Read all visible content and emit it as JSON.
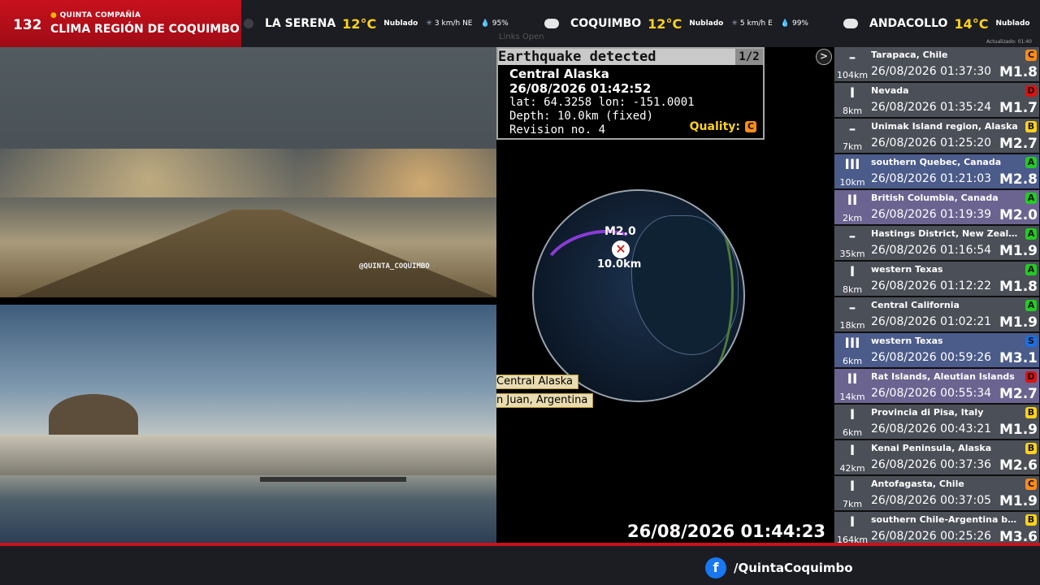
{
  "brand": {
    "number": "132",
    "subtitle": "QUINTA COMPAÑÍA",
    "title": "CLIMA REGIÓN DE COQUIMBO"
  },
  "weather": [
    {
      "city": "LA SERENA",
      "temp": "12°C",
      "cond": "Nublado",
      "wind": "3 km/h NE",
      "hum": "95%",
      "icon": "cloud-icon-dark"
    },
    {
      "city": "COQUIMBO",
      "temp": "12°C",
      "cond": "Nublado",
      "wind": "5 km/h E",
      "hum": "99%",
      "icon": "cloud-icon"
    },
    {
      "city": "ANDACOLLO",
      "temp": "14°C",
      "cond": "Nublado",
      "icon": "cloud-icon"
    }
  ],
  "updated_label": "Actualizado: 01:40",
  "ghost_menu": "Links   Open",
  "cam1_watermark": "@QUINTA_COQUIMBO",
  "alert": {
    "header": "Earthquake detected",
    "page": "1/2",
    "location": "Central Alaska",
    "datetime": "26/08/2026 01:42:52",
    "coords": "lat: 64.3258 lon: -151.0001",
    "depth": "Depth: 10.0km (fixed)",
    "revision": "Revision no. 4",
    "quality_label": "Quality:",
    "quality": "C"
  },
  "epicenter": {
    "magnitude": "M2.0",
    "depth": "10.0km"
  },
  "map_tags": [
    "Central Alaska",
    "n Juan, Argentina"
  ],
  "clock": "26/08/2026 01:44:23",
  "quakes": [
    {
      "int": "–",
      "depth": "104km",
      "region": "Tarapaca, Chile",
      "time": "26/08/2026 01:37:30",
      "mag": "M1.8",
      "quality": "C",
      "qcolor": "#ff8c1a",
      "style": "g"
    },
    {
      "int": "I",
      "depth": "8km",
      "region": "Nevada",
      "time": "26/08/2026 01:35:24",
      "mag": "M1.7",
      "quality": "D",
      "qcolor": "#e01010",
      "style": "g"
    },
    {
      "int": "–",
      "depth": "7km",
      "region": "Unimak Island region, Alaska",
      "time": "26/08/2026 01:25:20",
      "mag": "M2.7",
      "quality": "B",
      "qcolor": "#ffd21a",
      "style": "g"
    },
    {
      "int": "III",
      "depth": "10km",
      "region": "southern Quebec, Canada",
      "time": "26/08/2026 01:21:03",
      "mag": "M2.8",
      "quality": "A",
      "qcolor": "#22cc22",
      "style": "b"
    },
    {
      "int": "II",
      "depth": "2km",
      "region": "British Columbia, Canada",
      "time": "26/08/2026 01:19:39",
      "mag": "M2.0",
      "quality": "A",
      "qcolor": "#22cc22",
      "style": "p"
    },
    {
      "int": "–",
      "depth": "35km",
      "region": "Hastings District, New Zealand",
      "time": "26/08/2026 01:16:54",
      "mag": "M1.9",
      "quality": "A",
      "qcolor": "#22cc22",
      "style": "g"
    },
    {
      "int": "I",
      "depth": "8km",
      "region": "western Texas",
      "time": "26/08/2026 01:12:22",
      "mag": "M1.8",
      "quality": "A",
      "qcolor": "#22cc22",
      "style": "g"
    },
    {
      "int": "–",
      "depth": "18km",
      "region": "Central California",
      "time": "26/08/2026 01:02:21",
      "mag": "M1.9",
      "quality": "A",
      "qcolor": "#22cc22",
      "style": "g"
    },
    {
      "int": "III",
      "depth": "6km",
      "region": "western Texas",
      "time": "26/08/2026 00:59:26",
      "mag": "M3.1",
      "quality": "S",
      "qcolor": "#1a6fe0",
      "style": "b"
    },
    {
      "int": "II",
      "depth": "14km",
      "region": "Rat Islands, Aleutian Islands",
      "time": "26/08/2026 00:55:34",
      "mag": "M2.7",
      "quality": "D",
      "qcolor": "#e01010",
      "style": "p"
    },
    {
      "int": "I",
      "depth": "6km",
      "region": "Provincia di Pisa, Italy",
      "time": "26/08/2026 00:43:21",
      "mag": "M1.9",
      "quality": "B",
      "qcolor": "#ffd21a",
      "style": "g"
    },
    {
      "int": "I",
      "depth": "42km",
      "region": "Kenai Peninsula, Alaska",
      "time": "26/08/2026 00:37:36",
      "mag": "M2.6",
      "quality": "B",
      "qcolor": "#ffd21a",
      "style": "g"
    },
    {
      "int": "I",
      "depth": "7km",
      "region": "Antofagasta, Chile",
      "time": "26/08/2026 00:37:05",
      "mag": "M1.9",
      "quality": "C",
      "qcolor": "#ff8c1a",
      "style": "g"
    },
    {
      "int": "I",
      "depth": "164km",
      "region": "southern Chile-Argentina border",
      "time": "26/08/2026 00:25:26",
      "mag": "M3.6",
      "quality": "B",
      "qcolor": "#ffd21a",
      "style": "g"
    }
  ],
  "facebook": {
    "handle": "/QuintaCoquimbo",
    "icon": "facebook-icon"
  }
}
